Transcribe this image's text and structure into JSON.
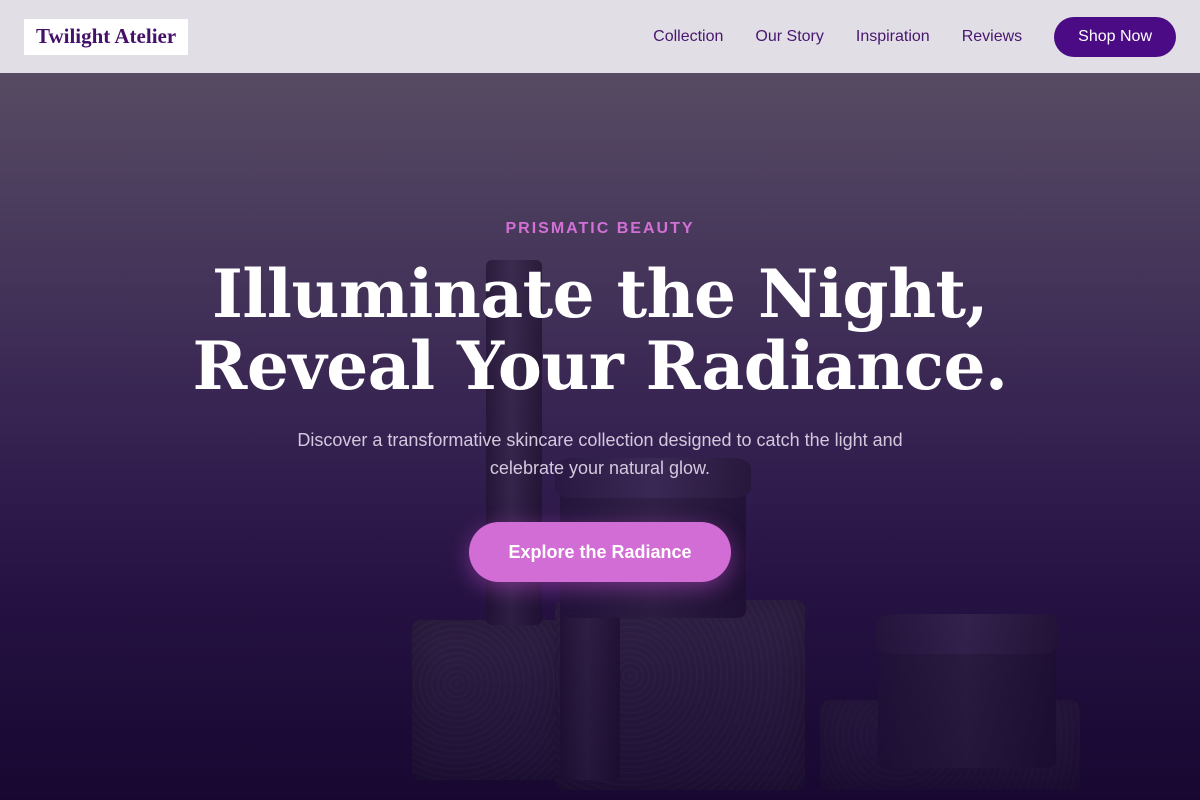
{
  "brand": {
    "name": "Twilight Atelier"
  },
  "nav": {
    "links": [
      "Collection",
      "Our Story",
      "Inspiration",
      "Reviews"
    ],
    "cta_label": "Shop Now"
  },
  "hero": {
    "eyebrow": "PRISMATIC BEAUTY",
    "headline_line1": "Illuminate the Night,",
    "headline_line2": "Reveal Your Radiance.",
    "subtext": "Discover a transformative skincare collection designed to catch the light and celebrate your natural glow.",
    "cta_label": "Explore the Radiance"
  },
  "colors": {
    "nav_background": "#e1dfe5",
    "nav_text": "#47166f",
    "shop_button": "#4a0b84",
    "accent": "#d36dd6",
    "hero_bottom": "#1c0a36"
  }
}
